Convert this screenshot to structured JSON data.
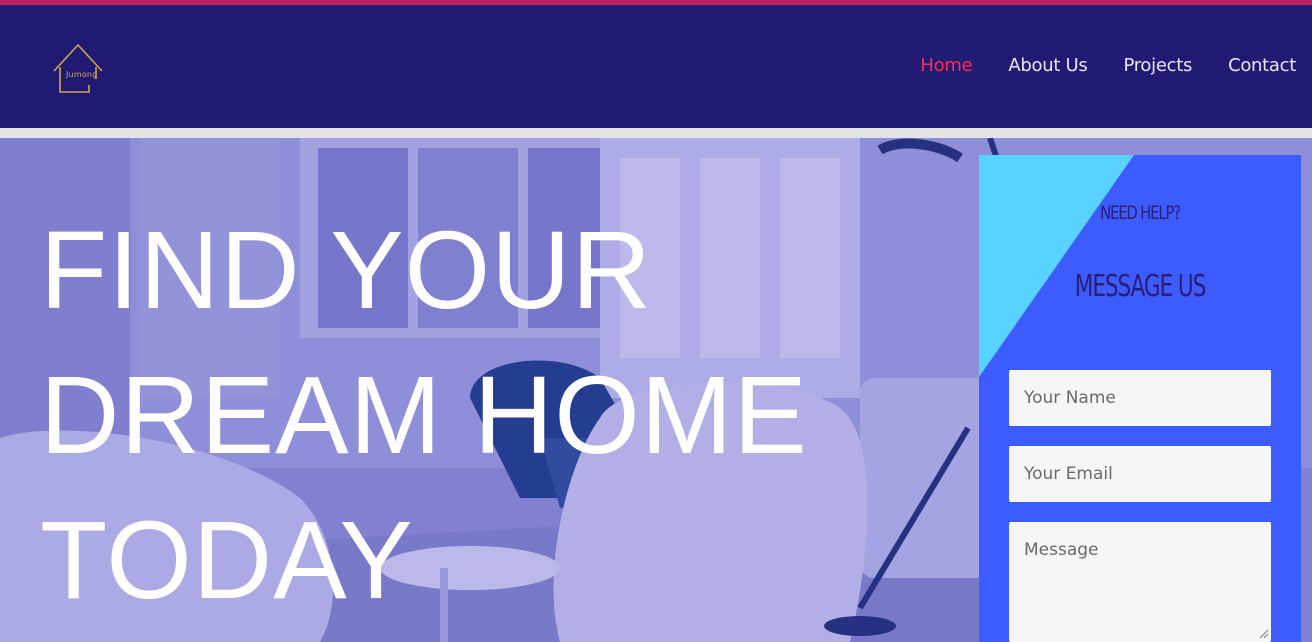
{
  "logo": {
    "text": "Jumong"
  },
  "nav": {
    "items": [
      {
        "label": "Home",
        "active": true
      },
      {
        "label": "About Us",
        "active": false
      },
      {
        "label": "Projects",
        "active": false
      },
      {
        "label": "Contact",
        "active": false
      }
    ]
  },
  "hero": {
    "headline_lines": [
      "FIND YOUR",
      "DREAM HOME",
      "TODAY"
    ]
  },
  "contact_form": {
    "need_help": "NEED HELP?",
    "title": "MESSAGE US",
    "name_placeholder": "Your Name",
    "email_placeholder": "Your Email",
    "message_placeholder": "Message"
  },
  "colors": {
    "top_stripe": "#b8235f",
    "navbar": "#211a73",
    "nav_active": "#ff2a4f",
    "form_panel": "#3d5cff",
    "form_accent": "#5ad2ff"
  }
}
